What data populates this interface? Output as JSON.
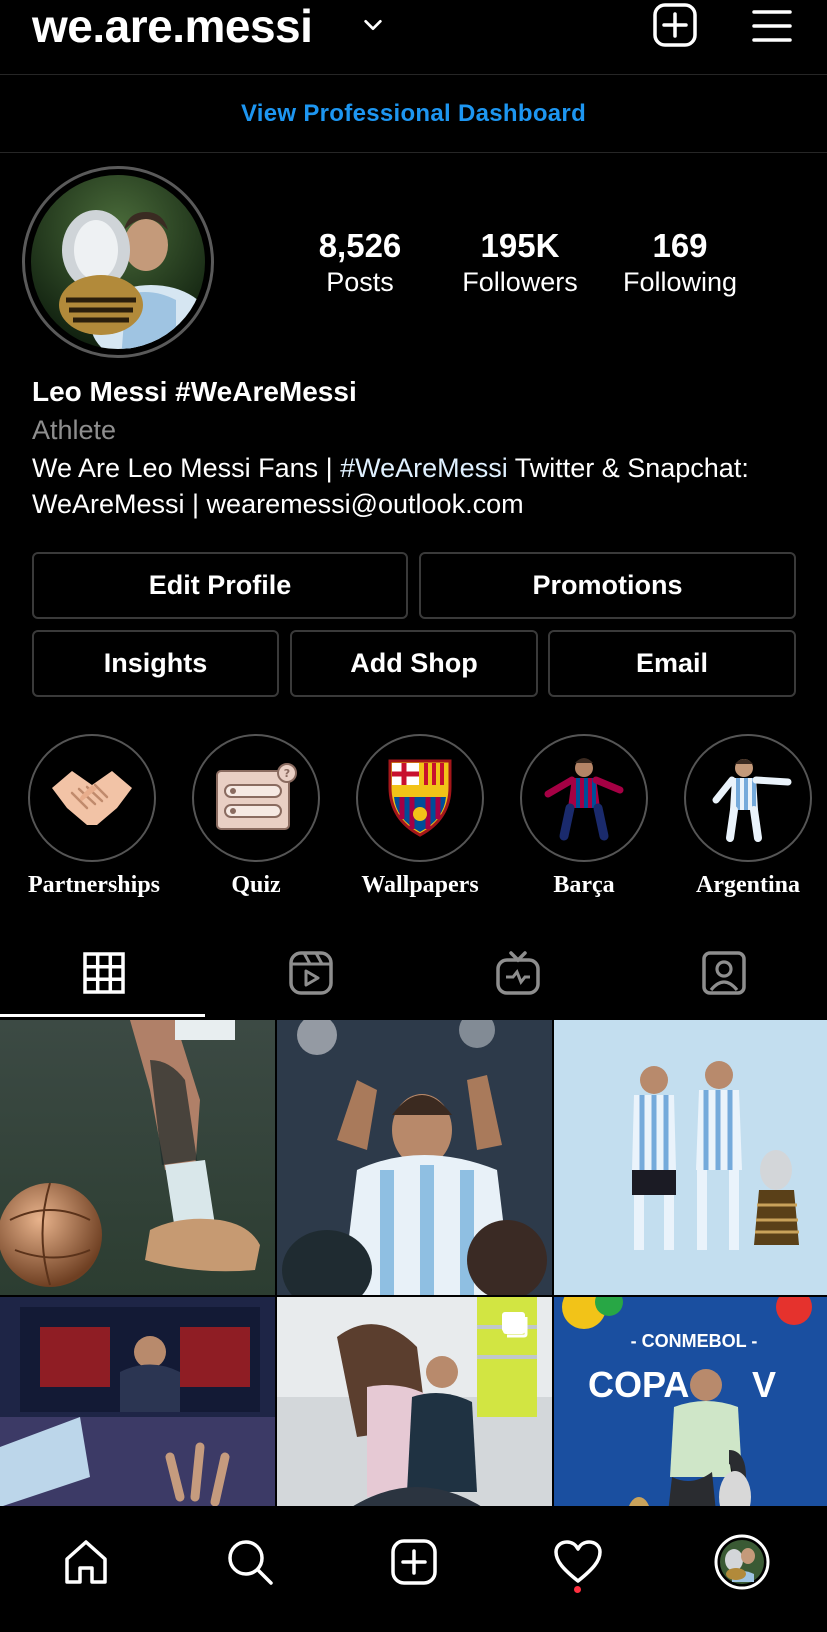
{
  "header": {
    "username": "we.are.messi",
    "dashboard_link": "View Professional Dashboard"
  },
  "stats": [
    {
      "value": "8,526",
      "label": "Posts"
    },
    {
      "value": "195K",
      "label": "Followers"
    },
    {
      "value": "169",
      "label": "Following"
    }
  ],
  "profile": {
    "display_name": "Leo Messi #WeAreMessi",
    "category": "Athlete",
    "bio_prefix": "We Are Leo Messi Fans | ",
    "bio_tag": "#WeAreMessi",
    "bio_suffix": " Twitter & Snapchat: WeAreMessi | weare­messi@outlook.com"
  },
  "buttons": {
    "edit_profile": "Edit Profile",
    "promotions": "Promotions",
    "insights": "Insights",
    "add_shop": "Add Shop",
    "email": "Email"
  },
  "highlights": [
    {
      "label": "Partnerships",
      "icon": "handshake-icon"
    },
    {
      "label": "Quiz",
      "icon": "quiz-box-icon"
    },
    {
      "label": "Wallpapers",
      "icon": "fcb-crest-icon"
    },
    {
      "label": "Barça",
      "icon": "barca-player-icon"
    },
    {
      "label": "Argentina",
      "icon": "argentina-player-icon"
    }
  ],
  "tabs": [
    "grid-icon",
    "reels-icon",
    "igtv-icon",
    "tagged-icon"
  ],
  "colors": {
    "accent_link": "#1d96f1",
    "notification_dot": "#ff3040",
    "background": "#000000"
  }
}
